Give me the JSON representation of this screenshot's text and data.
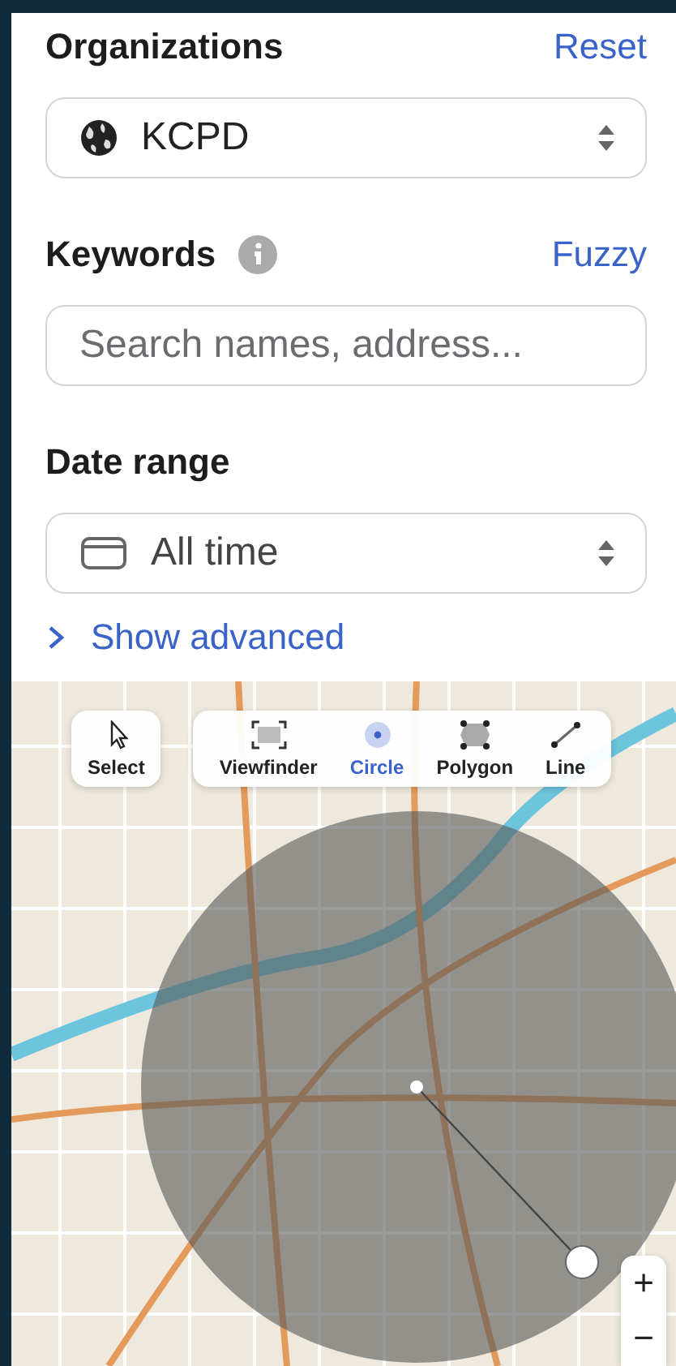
{
  "filters": {
    "organizations": {
      "label": "Organizations",
      "action": "Reset",
      "value": "KCPD"
    },
    "keywords": {
      "label": "Keywords",
      "action": "Fuzzy",
      "placeholder": "Search names, address..."
    },
    "date_range": {
      "label": "Date range",
      "value": "All time"
    },
    "advanced_link": {
      "label": "Show advanced",
      "expanded": false
    }
  },
  "map": {
    "tools": [
      {
        "kind": "select",
        "label": "Select",
        "selected": false
      },
      {
        "kind": "viewfinder",
        "label": "Viewfinder",
        "selected": false
      },
      {
        "kind": "circle",
        "label": "Circle",
        "selected": true
      },
      {
        "kind": "polygon",
        "label": "Polygon",
        "selected": false
      },
      {
        "kind": "line",
        "label": "Line",
        "selected": false
      }
    ],
    "zoom": {
      "in": "+",
      "out": "−"
    }
  }
}
